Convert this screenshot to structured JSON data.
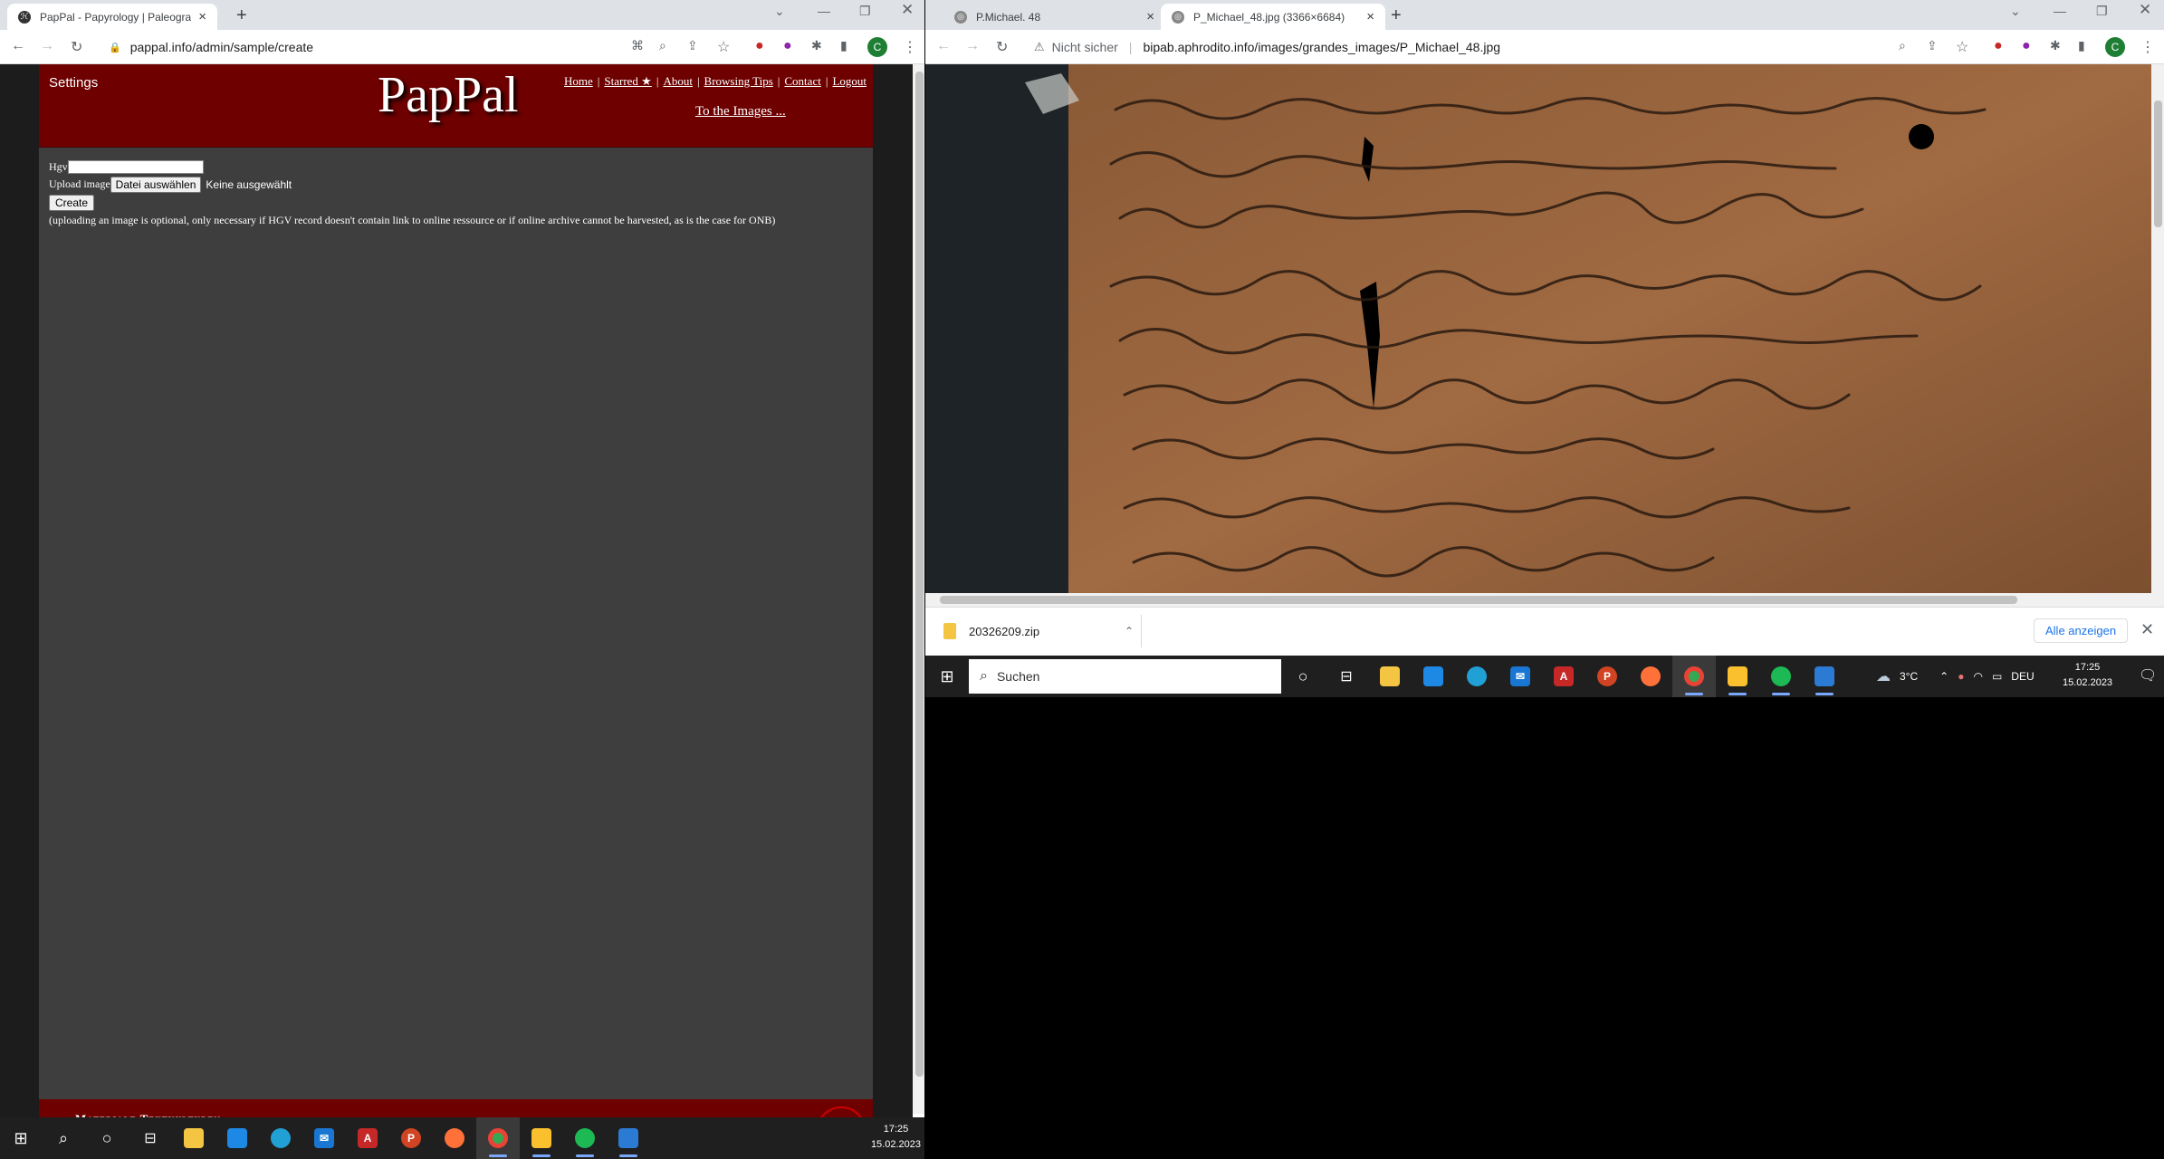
{
  "left_browser": {
    "tab_title": "PapPal - Papyrology | Paleograph",
    "url": "pappal.info/admin/sample/create",
    "profile_letter": "C"
  },
  "site": {
    "settings": "Settings",
    "logo": "PapPal",
    "nav": [
      "Home",
      "Starred ★",
      "About",
      "Browsing Tips",
      "Contact",
      "Logout"
    ],
    "nav_sep": "|",
    "images_link": "To the Images ...",
    "form": {
      "hgv_label": "Hgv",
      "hgv_value": "",
      "upload_label": "Upload image",
      "file_button": "Datei auswählen",
      "file_status": "Keine ausgewählt",
      "create_button": "Create",
      "note": "(uploading an image is optional, only necessary if HGV record doesn't contain link to online ressource or if online archive cannot be harvested, as is the case for ONB)"
    },
    "footer_text": "Materiale Textkulturen"
  },
  "right_browser": {
    "tabs": [
      "P.Michael. 48",
      "P_Michael_48.jpg (3366×6684)"
    ],
    "security": "Nicht sicher",
    "url": "bipab.aphrodito.info/images/grandes_images/P_Michael_48.jpg",
    "profile_letter": "C",
    "download_file": "20326209.zip",
    "download_all": "Alle anzeigen"
  },
  "taskbar_main": {
    "search_placeholder": "Suchen",
    "weather": "3°C",
    "lang": "DEU",
    "time": "17:25",
    "date": "15.02.2023"
  },
  "taskbar_left": {
    "time": "17:25",
    "date": "15.02.2023"
  },
  "colors": {
    "site_header": "#6e0000",
    "site_body": "#3e3e3e",
    "chrome_tabbar": "#dee1e6",
    "taskbar": "#1f1f1f"
  }
}
